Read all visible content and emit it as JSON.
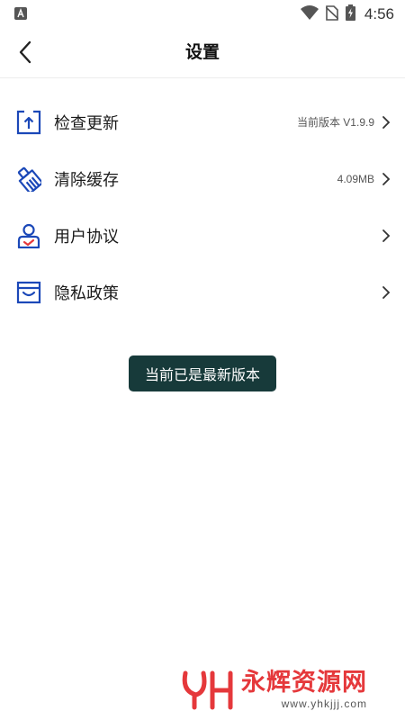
{
  "status_bar": {
    "time": "4:56",
    "icons": [
      "app-notification-icon",
      "wifi-icon",
      "no-sim-icon",
      "battery-charging-icon"
    ]
  },
  "header": {
    "title": "设置",
    "back_icon": "chevron-left-icon"
  },
  "menu": {
    "items": [
      {
        "icon": "upload-box-icon",
        "label": "检查更新",
        "value": "当前版本 V1.9.9"
      },
      {
        "icon": "broom-icon",
        "label": "清除缓存",
        "value": "4.09MB"
      },
      {
        "icon": "user-agreement-icon",
        "label": "用户协议",
        "value": ""
      },
      {
        "icon": "privacy-tray-icon",
        "label": "隐私政策",
        "value": ""
      }
    ]
  },
  "toast": {
    "text": "当前已是最新版本"
  },
  "watermark": {
    "title": "永辉资源网",
    "url": "www.yhkjjj.com"
  },
  "colors": {
    "accent": "#1b48b8",
    "toast_bg": "#173a3a",
    "watermark_red": "#e5383b"
  }
}
